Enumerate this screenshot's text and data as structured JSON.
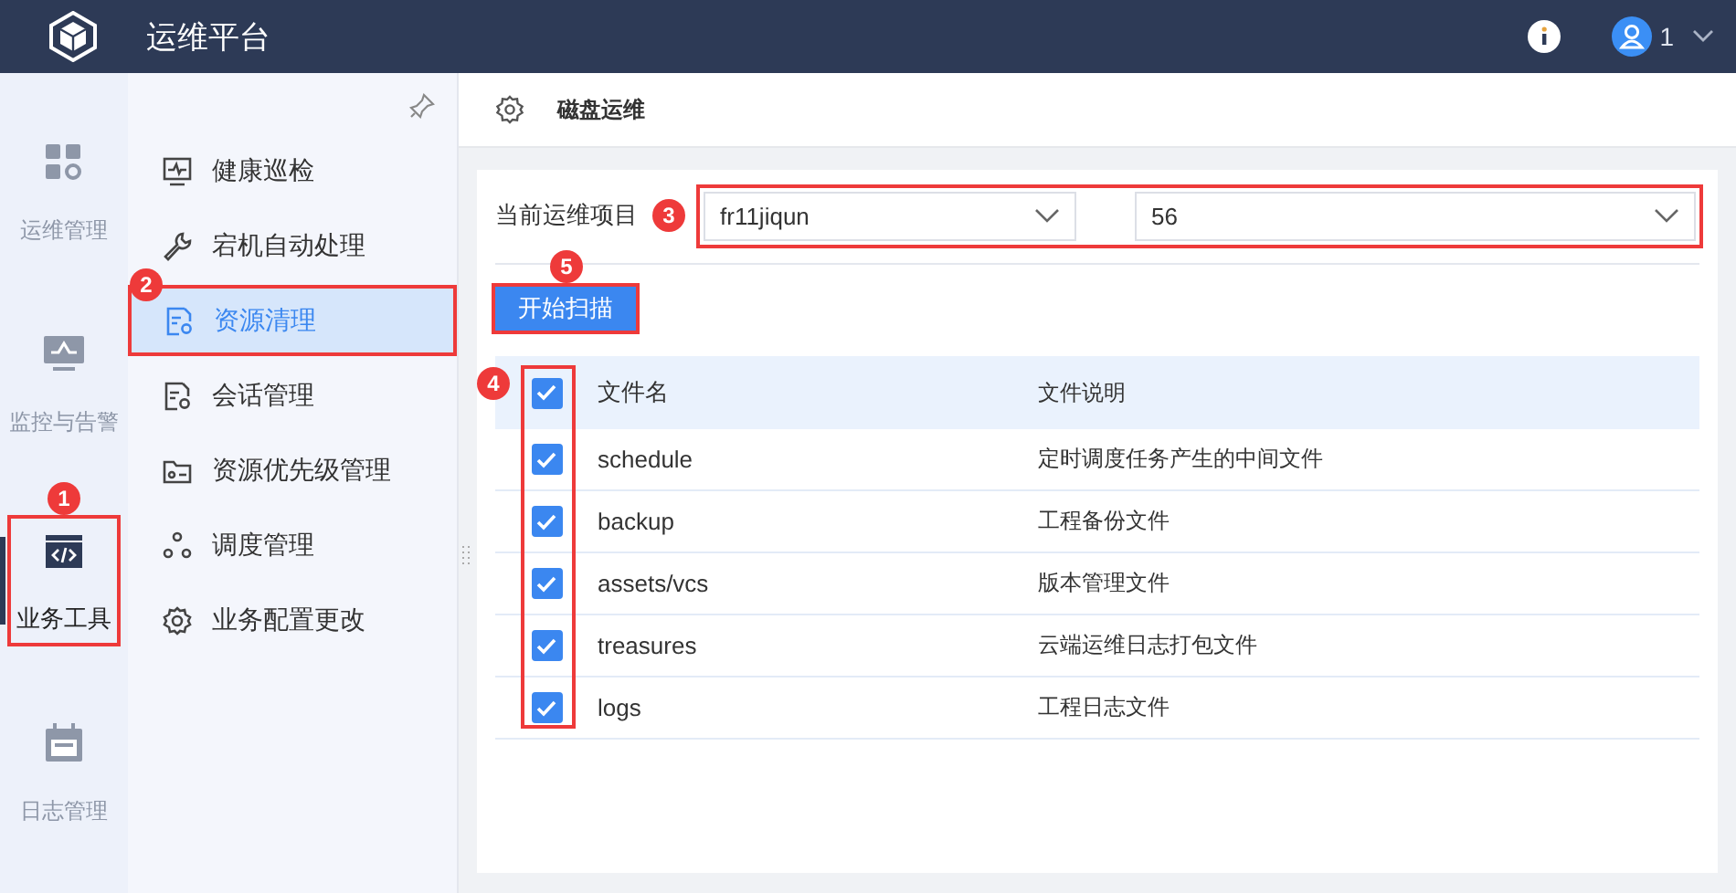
{
  "header": {
    "title": "运维平台",
    "user": "1"
  },
  "rail": [
    {
      "label": "运维管理",
      "selected": false
    },
    {
      "label": "监控与告警",
      "selected": false
    },
    {
      "label": "业务工具",
      "selected": true,
      "callout": "1"
    },
    {
      "label": "日志管理",
      "selected": false
    }
  ],
  "submenu": [
    {
      "label": "健康巡检",
      "selected": false
    },
    {
      "label": "宕机自动处理",
      "selected": false
    },
    {
      "label": "资源清理",
      "selected": true,
      "callout": "2"
    },
    {
      "label": "会话管理",
      "selected": false
    },
    {
      "label": "资源优先级管理",
      "selected": false
    },
    {
      "label": "调度管理",
      "selected": false
    },
    {
      "label": "业务配置更改",
      "selected": false
    }
  ],
  "page": {
    "title": "磁盘运维"
  },
  "project": {
    "label": "当前运维项目",
    "callout": "3",
    "cluster": "fr11jiqun",
    "node": "56"
  },
  "scan_button": {
    "label": "开始扫描",
    "callout": "5"
  },
  "table": {
    "callout": "4",
    "all_checked": true,
    "columns": [
      "文件名",
      "文件说明"
    ],
    "rows": [
      {
        "name": "schedule",
        "desc": "定时调度任务产生的中间文件",
        "checked": true
      },
      {
        "name": "backup",
        "desc": "工程备份文件",
        "checked": true
      },
      {
        "name": "assets/vcs",
        "desc": "版本管理文件",
        "checked": true
      },
      {
        "name": "treasures",
        "desc": "云端运维日志打包文件",
        "checked": true
      },
      {
        "name": "logs",
        "desc": "工程日志文件",
        "checked": true
      }
    ]
  }
}
